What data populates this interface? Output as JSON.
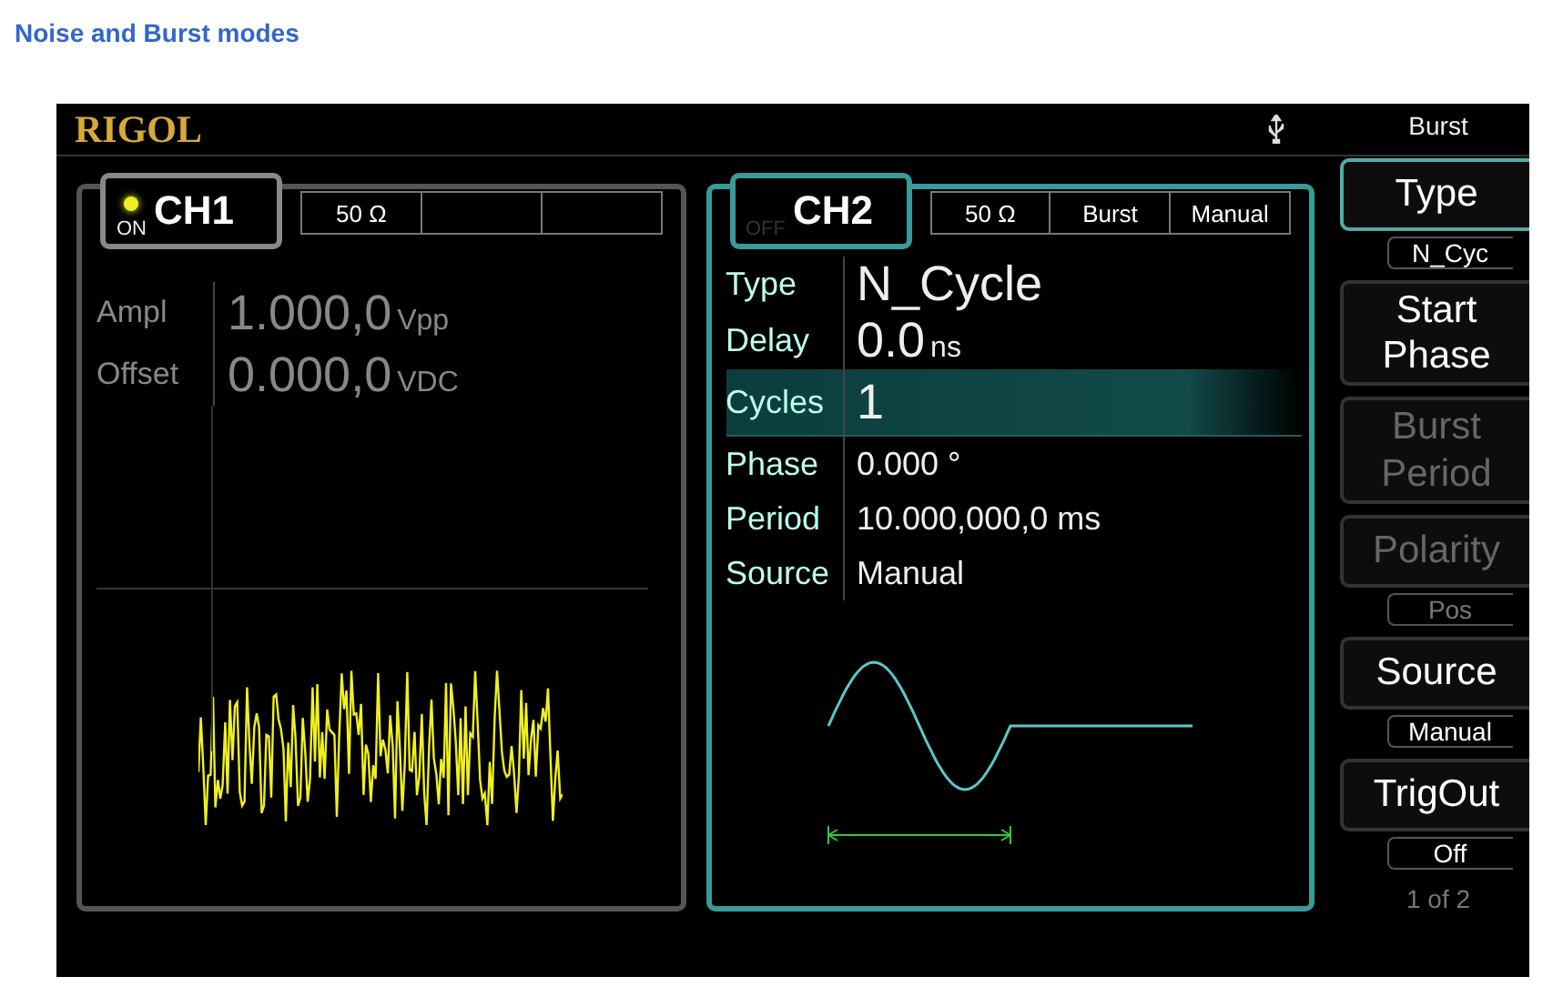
{
  "heading": "Noise and Burst modes",
  "top_bar": {
    "logo": "RIGOL"
  },
  "channels": [
    {
      "label": "CH1",
      "on": true,
      "state_label": "ON",
      "selected": false,
      "tags": [
        "50 Ω"
      ],
      "kind": "noise",
      "params": [
        {
          "label": "Ampl",
          "value": "1.000,0",
          "unit": "Vpp",
          "kind": "large",
          "selected": false
        },
        {
          "label": "Offset",
          "value": "0.000,0",
          "unit": "VDC",
          "kind": "large",
          "selected": false
        }
      ]
    },
    {
      "label": "CH2",
      "on": false,
      "state_label": "OFF",
      "selected": true,
      "tags": [
        "50 Ω",
        "Burst",
        "Manual"
      ],
      "kind": "burst",
      "params": [
        {
          "label": "Type",
          "value": "N_Cycle",
          "kind": "large",
          "selected": false
        },
        {
          "label": "Delay",
          "value": "0.0",
          "unit": "ns",
          "kind": "large",
          "selected": false
        },
        {
          "label": "Cycles",
          "value": "1",
          "kind": "large",
          "selected": true
        },
        {
          "label": "Phase",
          "value": "0.000 °",
          "kind": "small",
          "selected": false
        },
        {
          "label": "Period",
          "value": "10.000,000,0 ms",
          "kind": "small",
          "selected": false
        },
        {
          "label": "Source",
          "value": "Manual",
          "kind": "small",
          "selected": false
        }
      ]
    }
  ],
  "menu": {
    "title": "Burst",
    "page": "1 of 2",
    "items": [
      {
        "label": "Type",
        "value": "N_Cyc",
        "selected": true,
        "disabled": false
      },
      {
        "label": "Start Phase",
        "selected": false,
        "disabled": false
      },
      {
        "label": "Burst Period",
        "selected": false,
        "disabled": true
      },
      {
        "label": "Polarity",
        "value": "Pos",
        "selected": false,
        "disabled": true
      },
      {
        "label": "Source",
        "value": "Manual",
        "selected": false,
        "disabled": false
      },
      {
        "label": "TrigOut",
        "value": "Off",
        "selected": false,
        "disabled": false
      }
    ]
  }
}
